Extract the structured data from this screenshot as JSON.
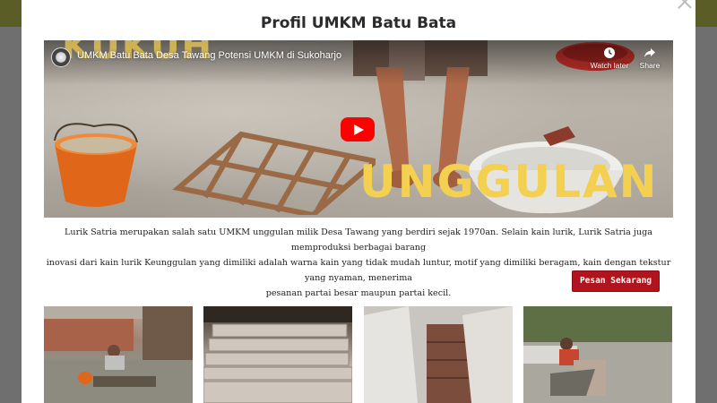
{
  "modal": {
    "title": "Profil UMKM Batu Bata"
  },
  "video": {
    "title": "UMKM Batu Bata Desa Tawang Potensi UMKM di Sukoharjo",
    "overlay_top_text": "KUKUH",
    "overlay_text": "UNGGULAN",
    "watch_later_label": "Watch later",
    "share_label": "Share"
  },
  "description": {
    "line1": "Lurik Satria merupakan salah satu UMKM unggulan milik Desa Tawang yang berdiri sejak 1970an. Selain kain lurik, Lurik Satria juga memproduksi berbagai barang",
    "line2": "inovasi dari kain lurik Keunggulan yang dimiliki adalah warna kain yang tidak mudah luntur, motif yang dimiliki beragam, kain dengan tekstur yang nyaman, menerima",
    "line3": "pesanan partai besar maupun partai kecil."
  },
  "actions": {
    "order_label": "Pesan Sekarang >>"
  },
  "colors": {
    "accent_red": "#b0151e",
    "overlay_yellow": "#f3d04f",
    "youtube_red": "#ff0000"
  },
  "icons": {
    "close": "close-icon",
    "watch_later": "clock-icon",
    "share": "share-icon",
    "play": "play-icon"
  }
}
